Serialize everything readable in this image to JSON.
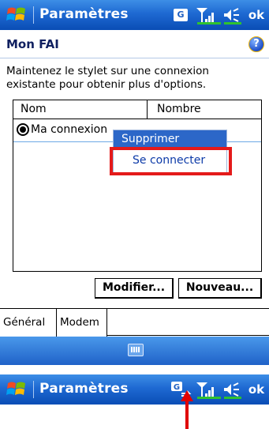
{
  "top_bar": {
    "title": "Paramètres",
    "ok_label": "ok",
    "status_icons": [
      "g-icon",
      "signal-icon",
      "speaker-icon"
    ],
    "g_label": "G"
  },
  "heading": {
    "title": "Mon FAI",
    "help_label": "?"
  },
  "instructions": "Maintenez le stylet sur une connexion existante pour obtenir plus d'options.",
  "list": {
    "columns": [
      "Nom",
      "Nombre"
    ],
    "rows": [
      {
        "name": "Ma connexion",
        "selected": true
      }
    ]
  },
  "context_menu": {
    "items": [
      "Supprimer",
      "Se connecter"
    ],
    "highlighted": "Se connecter"
  },
  "buttons": {
    "modify": "Modifier...",
    "new": "Nouveau..."
  },
  "tabs": [
    "Général",
    "Modem"
  ],
  "bottom_bar": {
    "title": "Paramètres",
    "ok_label": "ok",
    "g_label": "G"
  },
  "colors": {
    "title_bar": "#1e69d2",
    "selection": "#2c67c8",
    "highlight_box": "#e41a1a",
    "arrow": "#e00000"
  }
}
